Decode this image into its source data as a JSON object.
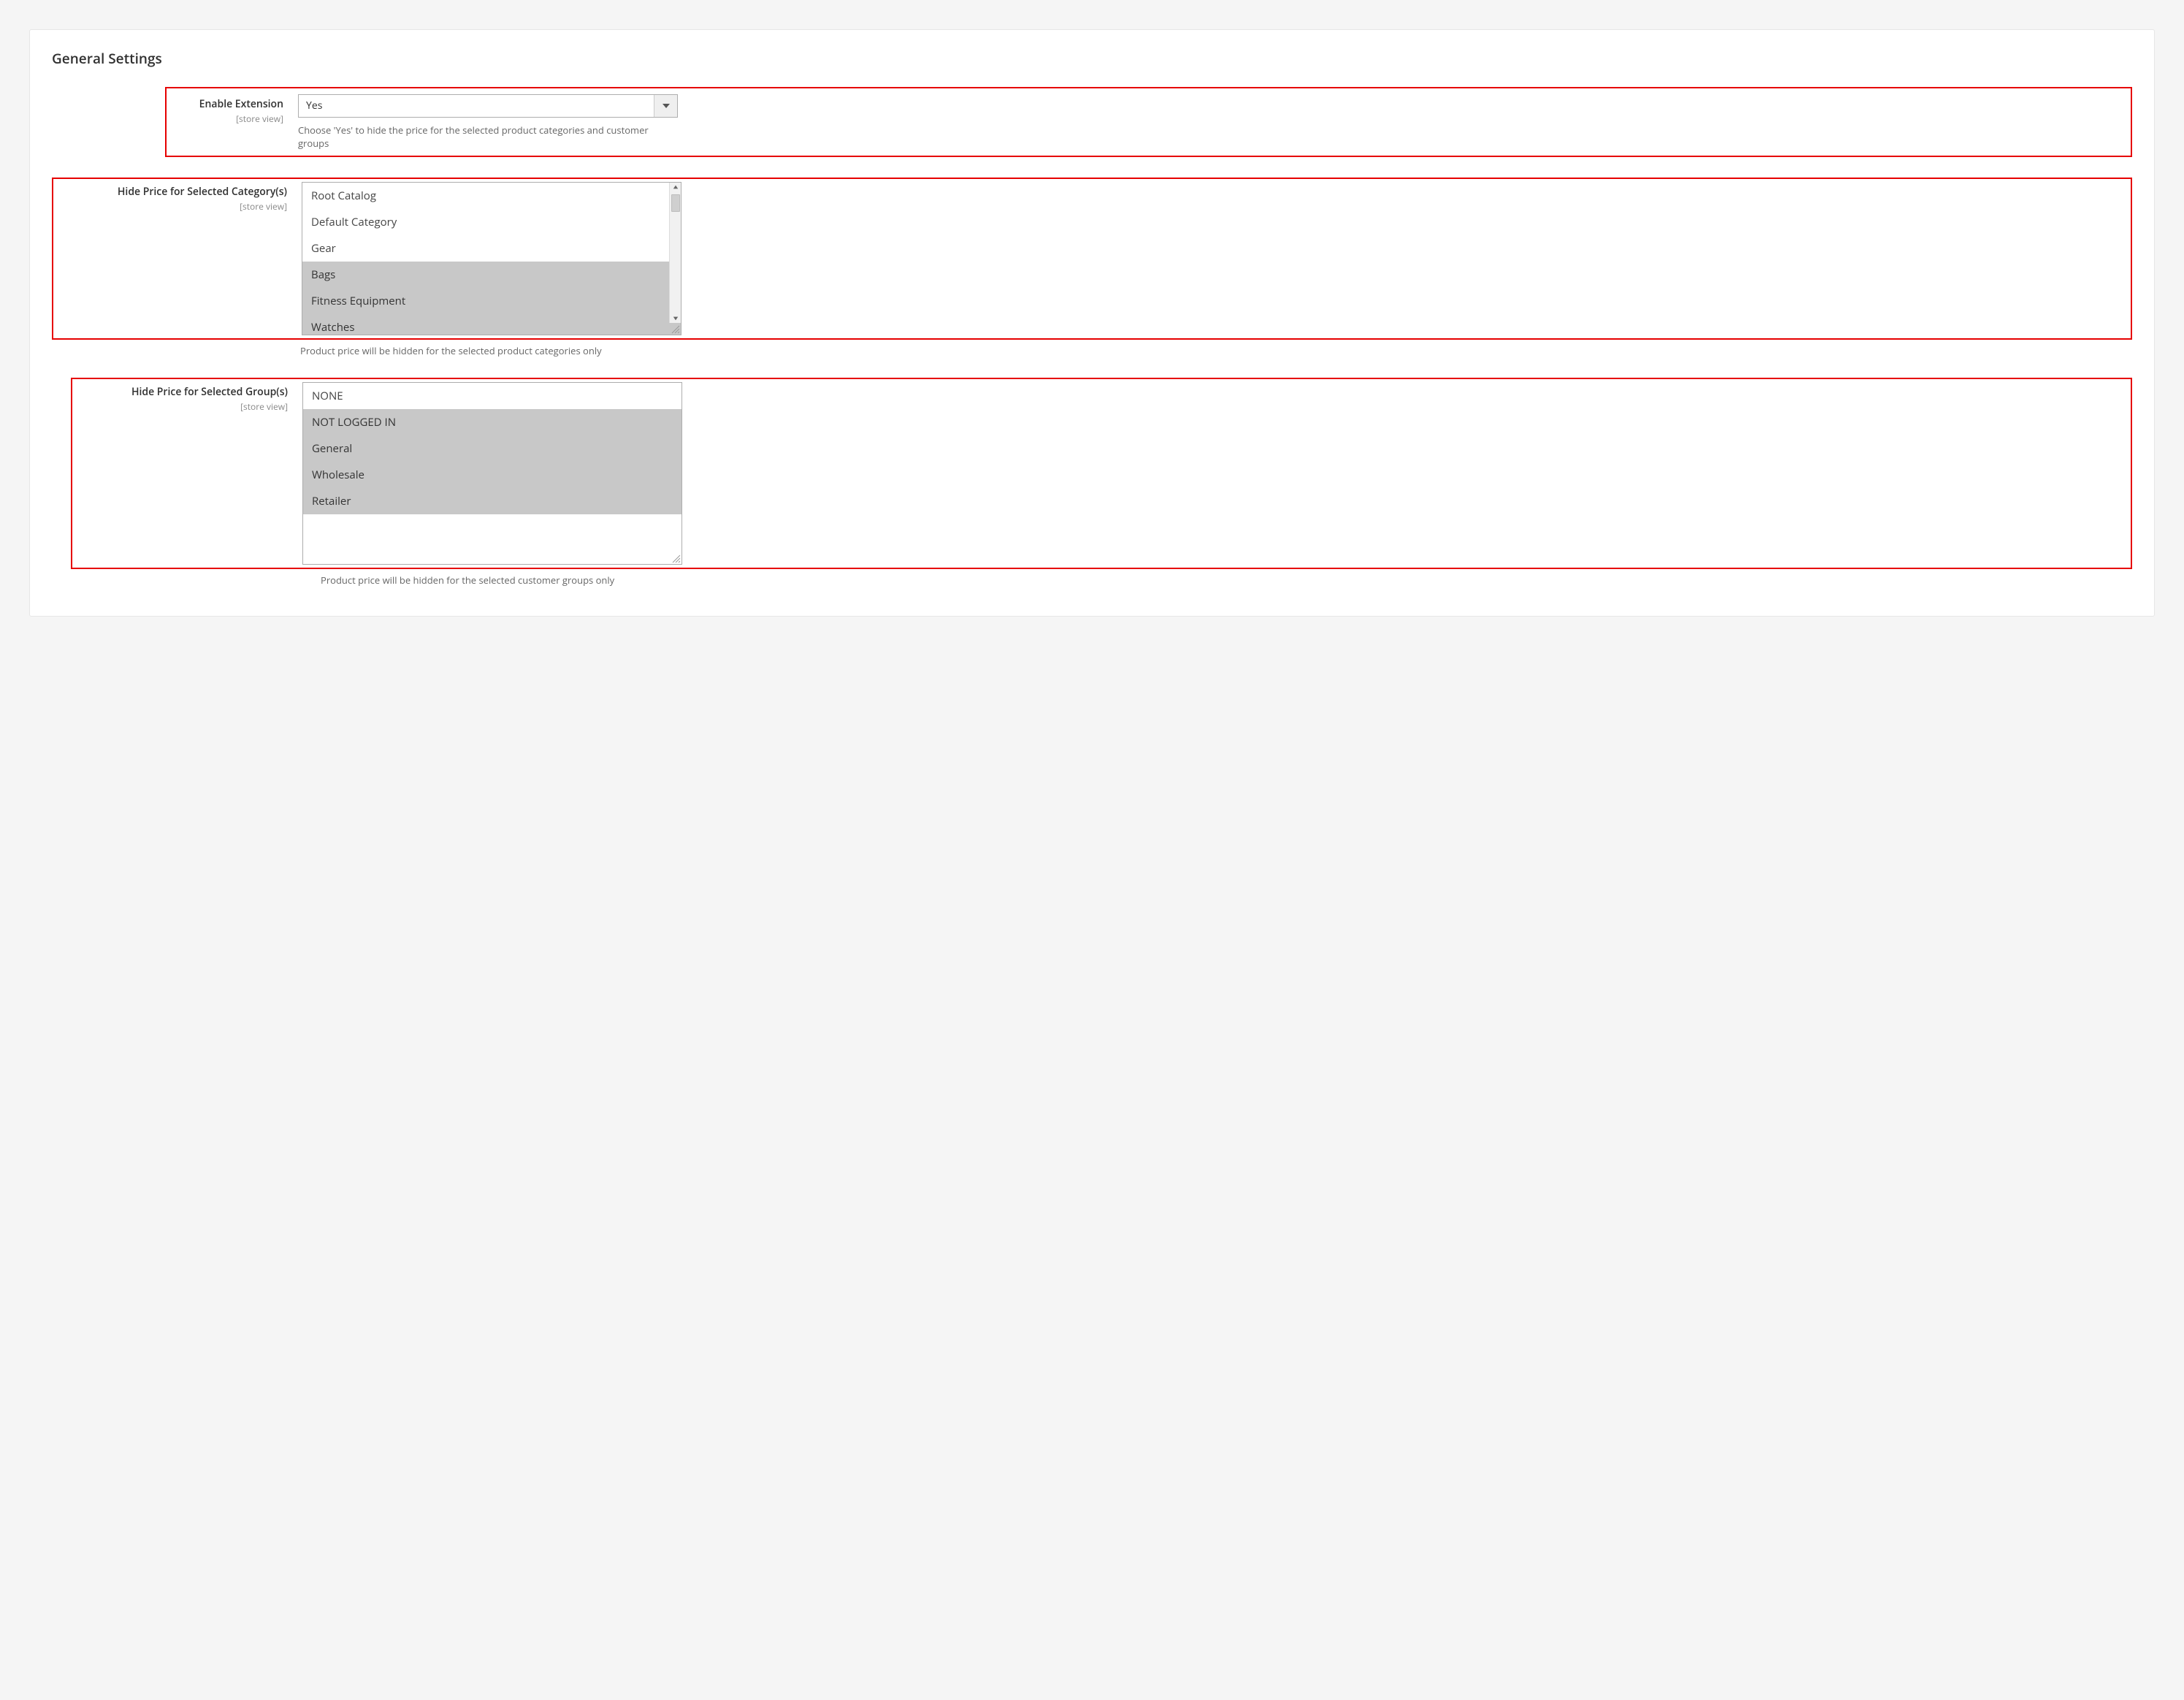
{
  "panel": {
    "title": "General Settings"
  },
  "fields": {
    "enable": {
      "label": "Enable Extension",
      "scope": "[store view]",
      "value": "Yes",
      "help": "Choose 'Yes' to hide the price for the selected product categories and customer groups"
    },
    "categories": {
      "label": "Hide Price for Selected Category(s)",
      "scope": "[store view]",
      "options": [
        {
          "text": "Root Catalog",
          "selected": false
        },
        {
          "text": "Default Category",
          "selected": false
        },
        {
          "text": "Gear",
          "selected": false
        },
        {
          "text": "Bags",
          "selected": true
        },
        {
          "text": "Fitness Equipment",
          "selected": true
        },
        {
          "text": "Watches",
          "selected": true
        }
      ],
      "help": "Product price will be hidden for the selected product categories only"
    },
    "groups": {
      "label": "Hide Price for Selected Group(s)",
      "scope": "[store view]",
      "options": [
        {
          "text": "NONE",
          "selected": false
        },
        {
          "text": "NOT LOGGED IN",
          "selected": true
        },
        {
          "text": "General",
          "selected": true
        },
        {
          "text": "Wholesale",
          "selected": true
        },
        {
          "text": "Retailer",
          "selected": true
        }
      ],
      "help": "Product price will be hidden for the selected customer groups only"
    }
  }
}
